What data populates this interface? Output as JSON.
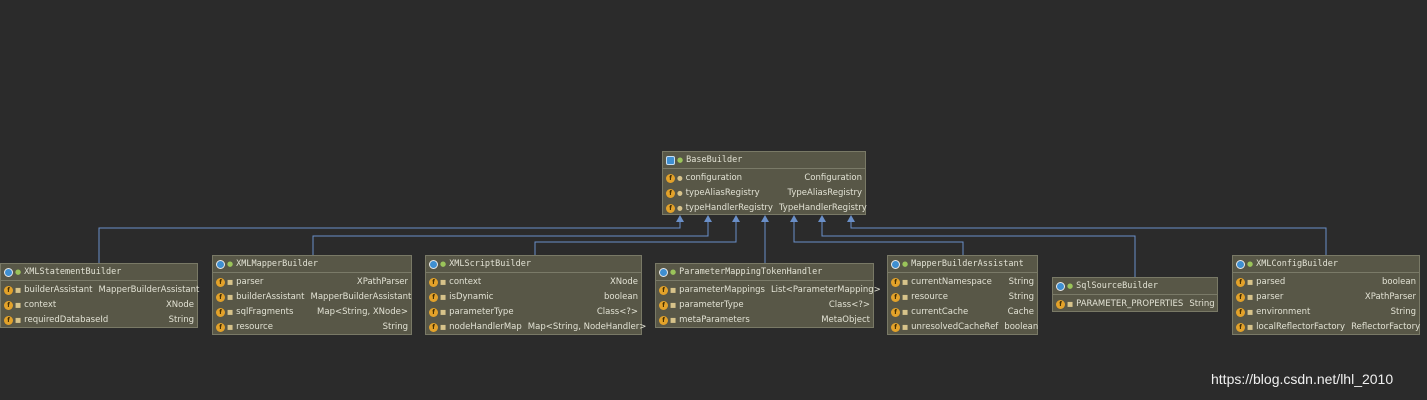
{
  "diagram": {
    "base": {
      "name": "BaseBuilder",
      "fields": [
        {
          "name": "configuration",
          "type": "Configuration"
        },
        {
          "name": "typeAliasRegistry",
          "type": "TypeAliasRegistry"
        },
        {
          "name": "typeHandlerRegistry",
          "type": "TypeHandlerRegistry"
        }
      ]
    },
    "classes": [
      {
        "id": "xml-statement-builder",
        "name": "XMLStatementBuilder",
        "fields": [
          {
            "name": "builderAssistant",
            "type": "MapperBuilderAssistant"
          },
          {
            "name": "context",
            "type": "XNode"
          },
          {
            "name": "requiredDatabaseId",
            "type": "String"
          }
        ]
      },
      {
        "id": "xml-mapper-builder",
        "name": "XMLMapperBuilder",
        "fields": [
          {
            "name": "parser",
            "type": "XPathParser"
          },
          {
            "name": "builderAssistant",
            "type": "MapperBuilderAssistant"
          },
          {
            "name": "sqlFragments",
            "type": "Map<String, XNode>"
          },
          {
            "name": "resource",
            "type": "String"
          }
        ]
      },
      {
        "id": "xml-script-builder",
        "name": "XMLScriptBuilder",
        "fields": [
          {
            "name": "context",
            "type": "XNode"
          },
          {
            "name": "isDynamic",
            "type": "boolean"
          },
          {
            "name": "parameterType",
            "type": "Class<?>"
          },
          {
            "name": "nodeHandlerMap",
            "type": "Map<String, NodeHandler>"
          }
        ]
      },
      {
        "id": "parameter-mapping-token-handler",
        "name": "ParameterMappingTokenHandler",
        "fields": [
          {
            "name": "parameterMappings",
            "type": "List<ParameterMapping>"
          },
          {
            "name": "parameterType",
            "type": "Class<?>"
          },
          {
            "name": "metaParameters",
            "type": "MetaObject"
          }
        ]
      },
      {
        "id": "mapper-builder-assistant",
        "name": "MapperBuilderAssistant",
        "fields": [
          {
            "name": "currentNamespace",
            "type": "String"
          },
          {
            "name": "resource",
            "type": "String"
          },
          {
            "name": "currentCache",
            "type": "Cache"
          },
          {
            "name": "unresolvedCacheRef",
            "type": "boolean"
          }
        ]
      },
      {
        "id": "sql-source-builder",
        "name": "SqlSourceBuilder",
        "fields": [
          {
            "name": "PARAMETER_PROPERTIES",
            "type": "String"
          }
        ]
      },
      {
        "id": "xml-config-builder",
        "name": "XMLConfigBuilder",
        "fields": [
          {
            "name": "parsed",
            "type": "boolean"
          },
          {
            "name": "parser",
            "type": "XPathParser"
          },
          {
            "name": "environment",
            "type": "String"
          },
          {
            "name": "localReflectorFactory",
            "type": "ReflectorFactory"
          }
        ]
      }
    ],
    "watermark": "https://blog.csdn.net/lhl_2010",
    "colors": {
      "edge": "#6a8fc8",
      "box": "#585747",
      "background": "#2b2b2b",
      "field_icon": "#e3a22a",
      "class_icon": "#3f8fd1"
    }
  }
}
